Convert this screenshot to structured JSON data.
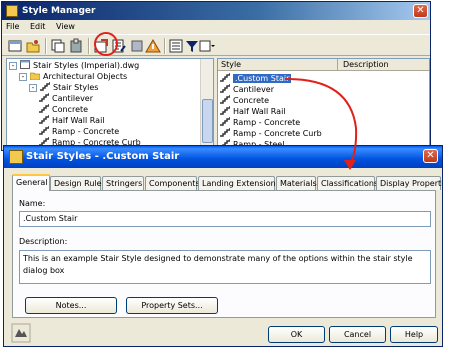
{
  "style_manager": {
    "title": "Style Manager",
    "menu": [
      "File",
      "Edit",
      "View"
    ],
    "tree": [
      {
        "label": "Stair Styles (Imperial).dwg",
        "level": 0,
        "toggle": "-",
        "icon": "drawing-icon"
      },
      {
        "label": "Architectural Objects",
        "level": 1,
        "toggle": "-",
        "icon": "folder-icon"
      },
      {
        "label": "Stair Styles",
        "level": 2,
        "toggle": "-",
        "icon": "stair-icon"
      },
      {
        "label": "Cantilever",
        "level": 3,
        "icon": "stair-icon"
      },
      {
        "label": "Concrete",
        "level": 3,
        "icon": "stair-icon"
      },
      {
        "label": "Half Wall Rail",
        "level": 3,
        "icon": "stair-icon"
      },
      {
        "label": "Ramp - Concrete",
        "level": 3,
        "icon": "stair-icon"
      },
      {
        "label": "Ramp - Concrete Curb",
        "level": 3,
        "icon": "stair-icon"
      }
    ],
    "list_headers": {
      "style": "Style",
      "description": "Description"
    },
    "list_items": [
      ".Custom Stair",
      "Cantilever",
      "Concrete",
      "Half Wall Rail",
      "Ramp - Concrete",
      "Ramp - Concrete Curb",
      "Ramp - Steel"
    ],
    "selected_item": ".Custom Stair"
  },
  "dialog": {
    "title": "Stair Styles - .Custom Stair",
    "tabs": [
      "General",
      "Design Rules",
      "Stringers",
      "Components",
      "Landing Extensions",
      "Materials",
      "Classifications",
      "Display Properties"
    ],
    "active_tab": "General",
    "name_label": "Name:",
    "name_value": ".Custom Stair",
    "description_label": "Description:",
    "description_value": "This is an example Stair Style designed to demonstrate many of the options within the stair style dialog box",
    "notes_button": "Notes...",
    "property_sets_button": "Property Sets...",
    "ok_button": "OK",
    "cancel_button": "Cancel",
    "help_button": "Help"
  },
  "colors": {
    "annotation": "#e0201a",
    "title_blue": "#0a246a",
    "selection": "#316ac5"
  }
}
